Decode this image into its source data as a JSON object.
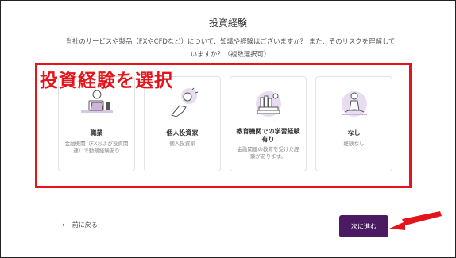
{
  "page": {
    "title": "投資経験",
    "question": "当社のサービスや製品（FXやCFDなど）について、知識や経験はございますか？ また、そのリスクを理解していますか？（複数選択可）"
  },
  "annotation": {
    "label": "投資経験を選択",
    "highlight_color": "#e3151a"
  },
  "options": [
    {
      "title": "職業",
      "description": "金融機関（FXおよび投資関連）で勤務経験あり",
      "icon": "office-worker-illustration"
    },
    {
      "title": "個人投資家",
      "description": "個人投資家",
      "icon": "hand-coin-illustration"
    },
    {
      "title": "教育機関での学習経験有り",
      "description": "金融関連の教育を受けた経験があります。",
      "icon": "books-illustration"
    },
    {
      "title": "なし",
      "description": "経験なし",
      "icon": "meditating-person-illustration"
    }
  ],
  "footer": {
    "back_label": "前に戻る",
    "next_label": "次に進む",
    "accent": "#4b1a63"
  }
}
